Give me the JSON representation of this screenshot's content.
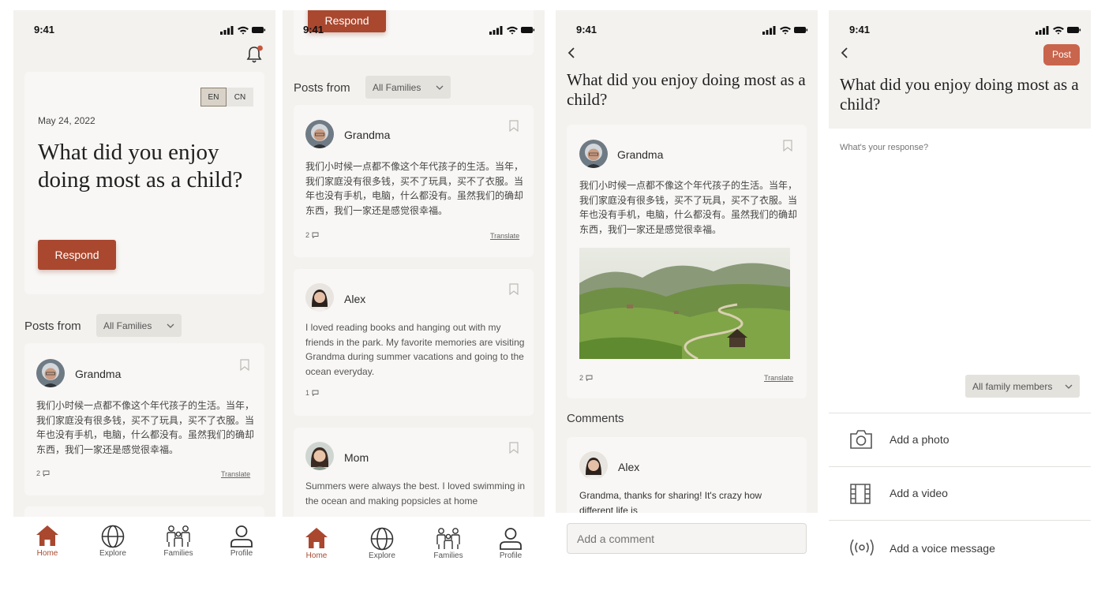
{
  "status": {
    "time": "9:41"
  },
  "prompt": {
    "date": "May 24, 2022",
    "question": "What did you enjoy doing most as a child?",
    "respond_label": "Respond",
    "lang_en": "EN",
    "lang_cn": "CN"
  },
  "filter": {
    "posts_from": "Posts from",
    "selected": "All Families"
  },
  "posts": [
    {
      "author": "Grandma",
      "text": "我们小时候一点都不像这个年代孩子的生活。当年，我们家庭没有很多钱，买不了玩具，买不了衣服。当年也没有手机，电脑，什么都没有。虽然我们的确却东西，我们一家还是感觉很幸福。",
      "comments": "2",
      "translate": "Translate"
    },
    {
      "author": "Alex",
      "text": "I loved reading books and hanging out with my friends in the park. My favorite memories are visiting Grandma during summer vacations and going to the ocean everyday.",
      "comments": "1"
    },
    {
      "author": "Mom",
      "text": "Summers were always the best. I loved swimming in the ocean and making popsicles at home"
    }
  ],
  "detail": {
    "comments_heading": "Comments",
    "comment": {
      "author": "Alex",
      "text": "Grandma, thanks for sharing! It's crazy how different life is"
    },
    "add_comment_placeholder": "Add a comment"
  },
  "compose": {
    "post_label": "Post",
    "placeholder": "What's your response?",
    "audience": "All family members",
    "options": [
      "Add a photo",
      "Add a video",
      "Add a voice message"
    ]
  },
  "nav": [
    "Home",
    "Explore",
    "Families",
    "Profile"
  ],
  "colors": {
    "accent": "#a9482f",
    "background": "#f3f2ef",
    "card": "#f8f7f5"
  },
  "icons": {
    "notification": "bell-icon",
    "back": "chevron-left-icon",
    "bookmark": "bookmark-icon",
    "comment": "comment-icon"
  }
}
